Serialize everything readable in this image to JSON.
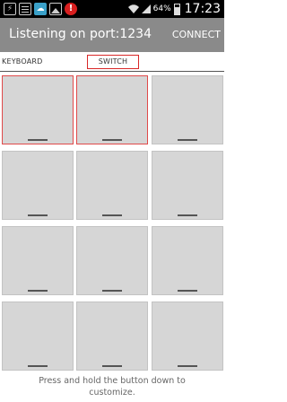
{
  "status_bar": {
    "icons": [
      "usb-icon",
      "notification-icon",
      "cloud-icon",
      "image-icon",
      "warning-icon"
    ],
    "battery_percent": "64%",
    "time": "17:23"
  },
  "action_bar": {
    "title": "Listening on port:1234",
    "connect_label": "CONNECT"
  },
  "tabs": [
    {
      "label": "KEYBOARD",
      "selected": false
    },
    {
      "label": "SWITCH",
      "selected": true
    }
  ],
  "grid": {
    "rows": 4,
    "cols": 3,
    "selected_cells": [
      0,
      1
    ]
  },
  "hint": "Press and hold the button down to customize.",
  "colors": {
    "action_bar": "#8a8a8a",
    "selection": "#e04a4a",
    "cell": "#d6d6d6"
  }
}
